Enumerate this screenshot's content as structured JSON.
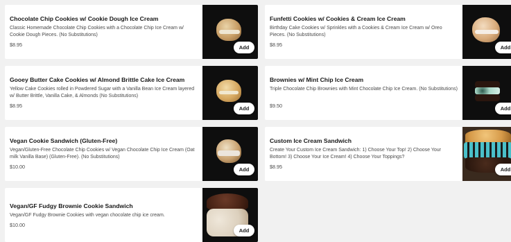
{
  "menu": {
    "items": [
      {
        "title": "Chocolate Chip Cookies w/ Cookie Dough Ice Cream",
        "description": "Classic Homemade Chocolate Chip Cookies with a Chocolate Chip Ice Cream w/ Cookie Dough Pieces. (No Substitutions)",
        "price": "$8.95",
        "add_label": "Add",
        "image_icon": "cookie-sandwich-image"
      },
      {
        "title": "Funfetti Cookies w/ Cookies & Cream Ice Cream",
        "description": "Birthday Cake Cookies w/ Sprinkles with a Cookies & Cream Ice Cream w/ Oreo Pieces. (No Substitutions)",
        "price": "$8.95",
        "add_label": "Add",
        "image_icon": "cookie-sandwich-image"
      },
      {
        "title": "Gooey Butter Cake Cookies w/ Almond Brittle Cake Ice Cream",
        "description": "Yellow Cake Cookies rolled in Powdered Sugar with a Vanilla Bean Ice Cream layered w/ Butter Brittle, Vanilla Cake, & Almonds (No Substitutions)",
        "price": "$8.95",
        "add_label": "Add",
        "image_icon": "cookie-sandwich-image"
      },
      {
        "title": "Brownies w/ Mint Chip Ice Cream",
        "description": "Triple Chocolate Chip Brownies with Mint Chocolate Chip Ice Cream. (No Substitutions)",
        "price": "$9.50",
        "add_label": "Add",
        "image_icon": "brownie-sandwich-image"
      },
      {
        "title": "Vegan Cookie Sandwich (Gluten-Free)",
        "description": "Vegan/Gluten-Free Chocolate Chip Cookies w/ Vegan Chocolate Chip Ice Cream (Oat milk Vanilla Base) (Gluten-Free). (No Substitutions)",
        "price": "$10.00",
        "add_label": "Add",
        "image_icon": "cookie-sandwich-image"
      },
      {
        "title": "Custom Ice Cream Sandwich",
        "description": "Create Your Custom Ice Cream Sandwich: 1) Choose Your Top! 2) Choose Your Bottom! 3) Choose Your Ice Cream! 4) Choose Your Toppings?",
        "price": "$8.95",
        "add_label": "Add",
        "image_icon": "custom-sandwich-image"
      },
      {
        "title": "Vegan/GF Fudgy Brownie Cookie Sandwich",
        "description": "Vegan/GF Fudgy Brownie Cookies with vegan chocolate chip ice cream.",
        "price": "$10.00",
        "add_label": "Add",
        "image_icon": "brownie-cookie-sandwich-image"
      }
    ]
  }
}
